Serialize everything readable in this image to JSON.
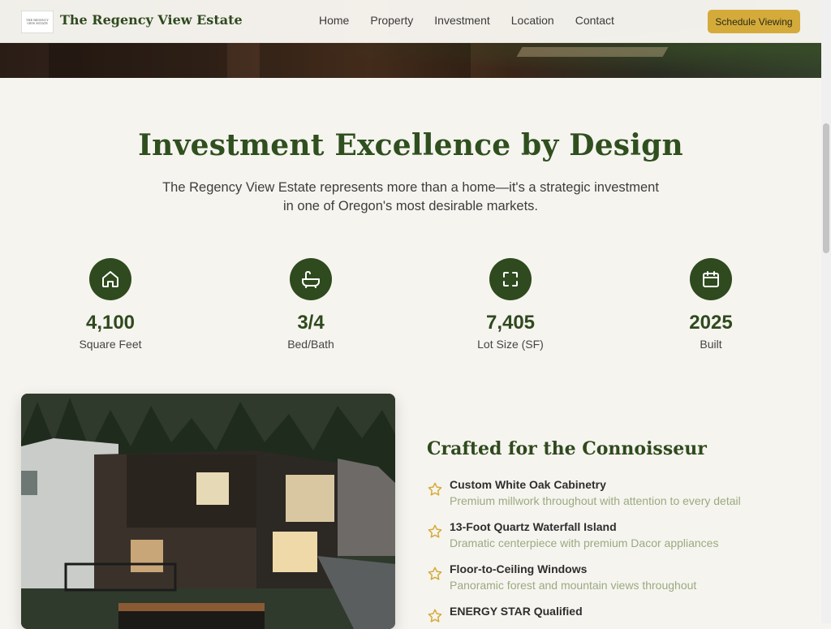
{
  "header": {
    "logo_text": "THE REGENCY VIEW ESTATE",
    "brand": "The Regency View Estate",
    "nav": [
      "Home",
      "Property",
      "Investment",
      "Location",
      "Contact"
    ],
    "cta": "Schedule Viewing"
  },
  "investment": {
    "title": "Investment Excellence by Design",
    "lead": "The Regency View Estate represents more than a home—it's a strategic investment in one of Oregon's most desirable markets."
  },
  "stats": [
    {
      "icon": "house-icon",
      "value": "4,100",
      "label": "Square Feet"
    },
    {
      "icon": "bathtub-icon",
      "value": "3/4",
      "label": "Bed/Bath"
    },
    {
      "icon": "expand-icon",
      "value": "7,405",
      "label": "Lot Size (SF)"
    },
    {
      "icon": "calendar-icon",
      "value": "2025",
      "label": "Built"
    }
  ],
  "features": {
    "title": "Crafted for the Connoisseur",
    "items": [
      {
        "title": "Custom White Oak Cabinetry",
        "desc": "Premium millwork throughout with attention to every detail"
      },
      {
        "title": "13-Foot Quartz Waterfall Island",
        "desc": "Dramatic centerpiece with premium Dacor appliances"
      },
      {
        "title": "Floor-to-Ceiling Windows",
        "desc": "Panoramic forest and mountain views throughout"
      },
      {
        "title": "ENERGY STAR Qualified",
        "desc": ""
      }
    ]
  },
  "colors": {
    "primary": "#2f4a1e",
    "accent": "#d4ab3a",
    "background": "#f6f4ef",
    "muted_text": "#9aaa80"
  }
}
